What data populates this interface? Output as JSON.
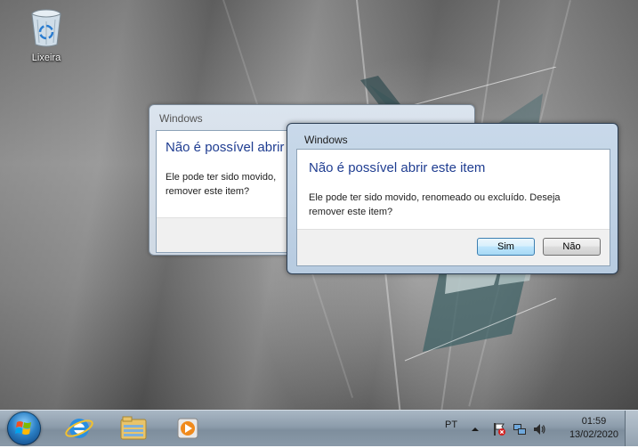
{
  "desktop": {
    "icons": [
      {
        "label": "Lixeira",
        "icon": "recycle-bin-icon"
      }
    ]
  },
  "dialog_back": {
    "title": "Windows",
    "heading": "Não é possível abrir",
    "message_line1": "Ele pode ter sido movido,",
    "message_line2": "remover este item?"
  },
  "dialog_front": {
    "title": "Windows",
    "heading": "Não é possível abrir este item",
    "message_line1": "Ele pode ter sido movido, renomeado ou excluído. Deseja",
    "message_line2": "remover este item?",
    "yes_label": "Sim",
    "no_label": "Não"
  },
  "taskbar": {
    "start": "start-orb-icon",
    "pinned": [
      "internet-explorer-icon",
      "windows-explorer-icon",
      "media-player-icon"
    ],
    "language": "PT",
    "tray_icons": [
      "show-hidden-icons-chevron",
      "action-center-flag-icon",
      "network-icon",
      "volume-icon"
    ],
    "time": "01:59",
    "date": "13/02/2020"
  },
  "colors": {
    "heading": "#1f3d91",
    "taskbar": "#8c9cab"
  }
}
